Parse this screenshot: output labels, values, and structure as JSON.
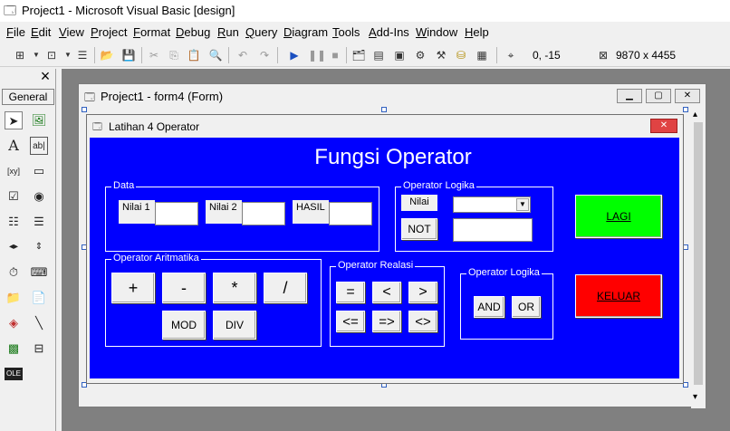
{
  "window": {
    "title": "Project1 - Microsoft Visual Basic [design]"
  },
  "menu": [
    "File",
    "Edit",
    "View",
    "Project",
    "Format",
    "Debug",
    "Run",
    "Query",
    "Diagram",
    "Tools",
    "Add-Ins",
    "Window",
    "Help"
  ],
  "toolbar": {
    "position": "0, -15",
    "size": "9870 x 4455"
  },
  "toolbox": {
    "header": "General",
    "close": "×"
  },
  "mdi": {
    "title": "Project1 - form4 (Form)"
  },
  "form": {
    "caption": "Latihan 4 Operator",
    "heading": "Fungsi Operator",
    "data_frame": {
      "title": "Data",
      "labels": [
        "Nilai 1",
        "Nilai 2",
        "HASIL"
      ]
    },
    "logic_frame_top": {
      "title": "Operator Logika",
      "label": "Nilai",
      "not_button": "NOT"
    },
    "arith_frame": {
      "title": "Operator Aritmatika",
      "buttons": [
        "+",
        "-",
        "*",
        "/",
        "MOD",
        "DIV"
      ]
    },
    "relation_frame": {
      "title": "Operator Realasi",
      "buttons": [
        "=",
        "<",
        ">",
        "<=",
        "=>",
        "<>"
      ]
    },
    "logic_frame_bottom": {
      "title": "Operator Logika",
      "buttons": [
        "AND",
        "OR"
      ]
    },
    "lagi_button": "LAGI",
    "keluar_button": "KELUAR"
  },
  "colors": {
    "form_bg": "#0000ff",
    "lagi": "#00ff00",
    "keluar": "#ff0000"
  }
}
